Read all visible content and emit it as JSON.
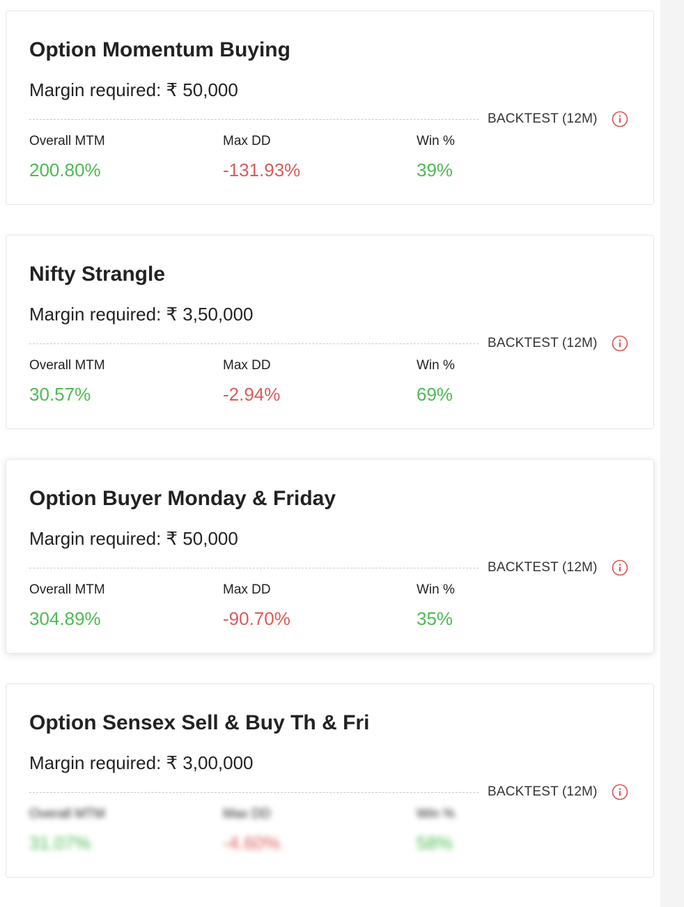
{
  "cards": [
    {
      "title": "Option Momentum Buying",
      "margin": "Margin required: ₹ 50,000",
      "backtest": "BACKTEST (12M)",
      "metrics": [
        {
          "label": "Overall MTM",
          "value": "200.80%"
        },
        {
          "label": "Max DD",
          "value": "-131.93%"
        },
        {
          "label": "Win %",
          "value": "39%"
        }
      ]
    },
    {
      "title": "Nifty Strangle",
      "margin": "Margin required: ₹ 3,50,000",
      "backtest": "BACKTEST (12M)",
      "metrics": [
        {
          "label": "Overall MTM",
          "value": "30.57%"
        },
        {
          "label": "Max DD",
          "value": "-2.94%"
        },
        {
          "label": "Win %",
          "value": "69%"
        }
      ]
    },
    {
      "title": "Option Buyer Monday & Friday",
      "margin": "Margin required: ₹ 50,000",
      "backtest": "BACKTEST (12M)",
      "metrics": [
        {
          "label": "Overall MTM",
          "value": "304.89%"
        },
        {
          "label": "Max DD",
          "value": "-90.70%"
        },
        {
          "label": "Win %",
          "value": "35%"
        }
      ]
    },
    {
      "title": "Option Sensex Sell & Buy Th & Fri",
      "margin": "Margin required: ₹ 3,00,000",
      "backtest": "BACKTEST (12M)",
      "metrics": [
        {
          "label": "Overall MTM",
          "value": "31.07%"
        },
        {
          "label": "Max DD",
          "value": "-4.60%"
        },
        {
          "label": "Win %",
          "value": "58%"
        }
      ]
    }
  ],
  "colors": {
    "positive": "#4cbb52",
    "negative": "#dd5a5a",
    "info_icon": "#d9534f"
  },
  "icons": {
    "info": "info-circle-icon"
  }
}
